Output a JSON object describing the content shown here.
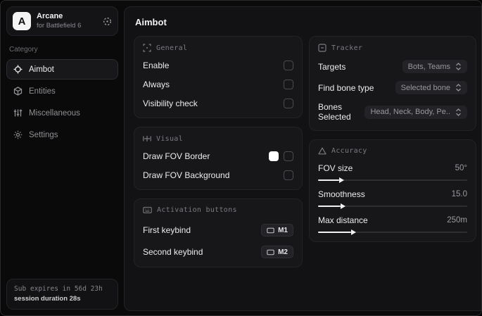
{
  "brand": {
    "logo_letter": "A",
    "title": "Arcane",
    "subtitle": "for Battlefield 6"
  },
  "sidebar": {
    "category_label": "Category",
    "items": [
      {
        "label": "Aimbot",
        "active": true
      },
      {
        "label": "Entities",
        "active": false
      },
      {
        "label": "Miscellaneous",
        "active": false
      },
      {
        "label": "Settings",
        "active": false
      }
    ],
    "subscription": {
      "expires": "Sub expires in 56d 23h",
      "session": "session duration 28s"
    }
  },
  "main": {
    "title": "Aimbot",
    "general": {
      "title": "General",
      "rows": [
        {
          "label": "Enable",
          "checked": false
        },
        {
          "label": "Always",
          "checked": false
        },
        {
          "label": "Visibility check",
          "checked": false
        }
      ]
    },
    "visual": {
      "title": "Visual",
      "rows": [
        {
          "label": "Draw FOV Border",
          "swatch": "#ffffff",
          "checked": false
        },
        {
          "label": "Draw FOV Background",
          "checked": false
        }
      ]
    },
    "activation": {
      "title": "Activation buttons",
      "rows": [
        {
          "label": "First keybind",
          "key": "M1"
        },
        {
          "label": "Second keybind",
          "key": "M2"
        }
      ]
    },
    "tracker": {
      "title": "Tracker",
      "rows": [
        {
          "label": "Targets",
          "value": "Bots, Teams"
        },
        {
          "label": "Find bone type",
          "value": "Selected bone"
        },
        {
          "label": "Bones Selected",
          "value": "Head, Neck, Body, Pe.."
        }
      ]
    },
    "accuracy": {
      "title": "Accuracy",
      "rows": [
        {
          "label": "FOV size",
          "value": "50°",
          "fill_pct": 14
        },
        {
          "label": "Smoothness",
          "value": "15.0",
          "fill_pct": 15
        },
        {
          "label": "Max distance",
          "value": "250m",
          "fill_pct": 22
        }
      ]
    }
  },
  "colors": {
    "accent": "#ffffff",
    "panel": "#17171a",
    "background": "#0a0a0b",
    "text_primary": "#ececee",
    "text_muted": "#8f8f94"
  }
}
